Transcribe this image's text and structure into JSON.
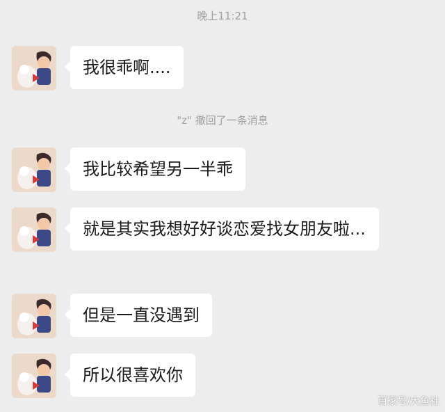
{
  "timestamp": "晚上11:21",
  "system_notice": "\"z\" 撤回了一条消息",
  "messages": [
    {
      "text": "我很乖啊...."
    },
    {
      "text": "我比较希望另一半乖"
    },
    {
      "text": "就是其实我想好好谈恋爱找女朋友啦..."
    },
    {
      "text": "但是一直没遇到"
    },
    {
      "text": "所以很喜欢你"
    }
  ],
  "watermark": "百家号/大鱼社"
}
